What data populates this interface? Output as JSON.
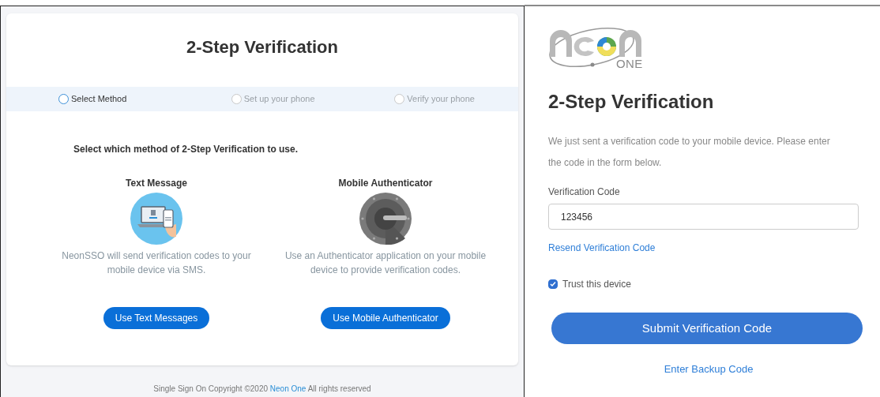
{
  "method_page": {
    "title": "2-Step Verification",
    "steps": [
      {
        "label": "Select Method",
        "selected": true
      },
      {
        "label": "Set up your phone",
        "selected": false
      },
      {
        "label": "Verify your phone",
        "selected": false
      }
    ],
    "instruction": "Select which method of 2-Step Verification to use.",
    "methods": [
      {
        "kind": "sms",
        "title": "Text Message",
        "description": "NeonSSO will send verification codes to your mobile device via SMS.",
        "button": "Use Text Messages"
      },
      {
        "kind": "authenticator",
        "title": "Mobile Authenticator",
        "description": "Use an Authenticator application on your mobile device to provide verification codes.",
        "button": "Use Mobile Authenticator"
      }
    ],
    "footer": {
      "before": "Single Sign On Copyright ©2020",
      "link": "Neon One",
      "after": "All rights reserved"
    }
  },
  "verify_page": {
    "logo_text": "ONE",
    "title": "2-Step Verification",
    "message": "We just sent a verification code to your mobile device. Please enter the code in the form below.",
    "field_label": "Verification Code",
    "field_value": "123456",
    "resend_link": "Resend Verification Code",
    "trust": {
      "label": "Trust this device",
      "checked": true
    },
    "submit": "Submit Verification Code",
    "backup_link": "Enter Backup Code"
  }
}
